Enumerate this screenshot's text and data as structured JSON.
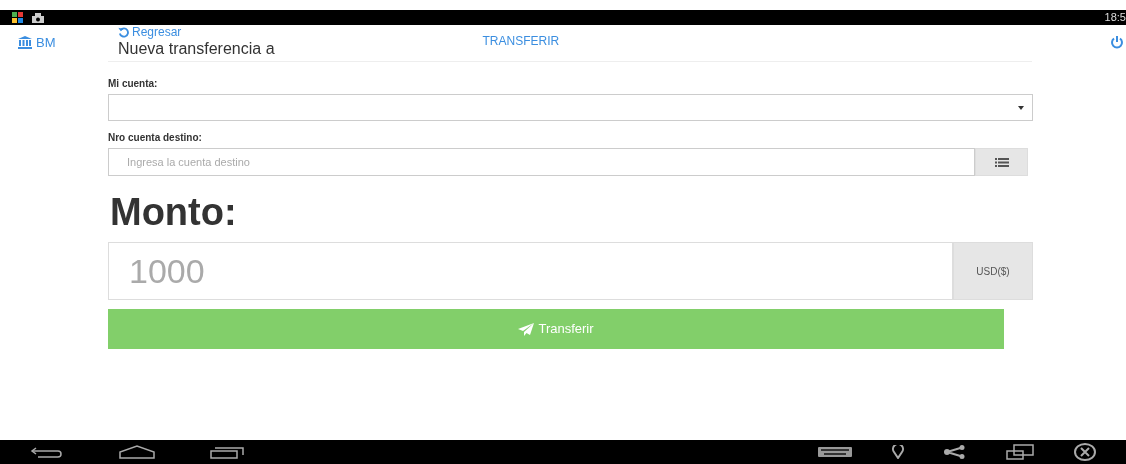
{
  "status_bar": {
    "time": "18:5"
  },
  "header": {
    "brand": "BM",
    "back": "Regresar",
    "title": "Nueva transferencia a",
    "action": "TRANSFERIR"
  },
  "form": {
    "account_label": "Mi cuenta:",
    "destination_label": "Nro cuenta destino:",
    "destination_placeholder": "Ingresa la cuenta destino",
    "amount_label": "Monto:",
    "amount_placeholder": "1000",
    "currency": "USD($)",
    "submit": "Transferir"
  }
}
